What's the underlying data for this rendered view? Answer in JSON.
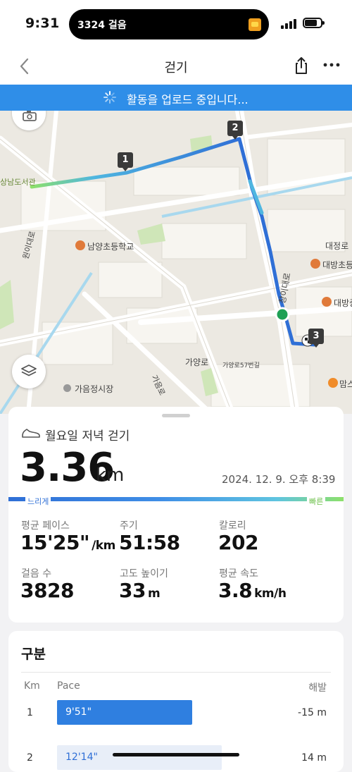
{
  "status_bar": {
    "time": "9:31",
    "island_text": "3324 걸음"
  },
  "header": {
    "title": "걷기",
    "back_icon": "chevron-left-icon",
    "share_icon": "share-icon",
    "more_icon": "more-horizontal-icon"
  },
  "banner": {
    "text": "활동을 업로드 중입니다..."
  },
  "map": {
    "labels": {
      "library": "상남도서관",
      "school": "남양초등학교",
      "road_daejeong": "대정로",
      "poi_daebang1": "대방초등",
      "poi_daebang2": "대방중",
      "road_wonidae": "원이대로",
      "road_changi": "창이대로",
      "road_gayang": "가양로",
      "road_gayang57": "가양로57번길",
      "road_gaeum": "가음로",
      "market": "가음정시장",
      "poi_mam": "맘스",
      "edge_te": "터"
    },
    "markers": [
      "1",
      "2",
      "3"
    ]
  },
  "summary": {
    "activity_name": "월요일 저녁 걷기",
    "distance_value": "3.36",
    "distance_unit": "km",
    "date": "2024. 12. 9. 오후 8:39",
    "slow_label": "느리게",
    "fast_label": "빠른",
    "stats": {
      "pace_label": "평균 페이스",
      "pace_value": "15'25\"",
      "pace_unit": "/km",
      "duration_label": "주기",
      "duration_value": "51:58",
      "calories_label": "칼로리",
      "calories_value": "202",
      "steps_label": "걸음 수",
      "steps_value": "3828",
      "elevation_label": "고도 높이기",
      "elevation_value": "33",
      "elevation_unit": "m",
      "speed_label": "평균 속도",
      "speed_value": "3.8",
      "speed_unit": "km/h"
    }
  },
  "splits": {
    "title": "구분",
    "col_km": "Km",
    "col_pace": "Pace",
    "col_elev": "해발",
    "rows": [
      {
        "km": "1",
        "pace": "9'51\"",
        "elevation": "-15 m",
        "bar_fraction": 0.64,
        "color": "#2f7fe0",
        "text_color": "#ffffff"
      },
      {
        "km": "2",
        "pace": "12'14\"",
        "elevation": "14 m",
        "bar_fraction": 0.78,
        "color": "#e8eef8",
        "text_color": "#2f6fd6"
      }
    ]
  },
  "colors": {
    "accent": "#2f8ee8",
    "route_start": "#8de06a",
    "route_end": "#2f6fd6"
  }
}
